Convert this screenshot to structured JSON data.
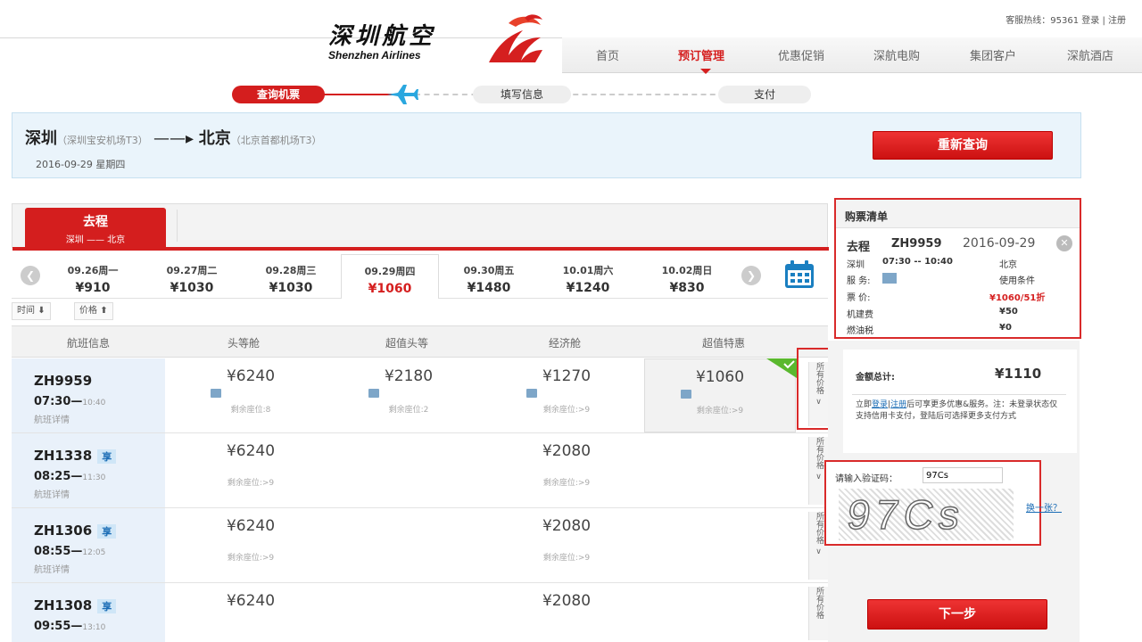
{
  "header": {
    "hotline": "客服热线：95361",
    "login": "登录",
    "register": "注册",
    "logo_cn": "深圳航空",
    "logo_en": "Shenzhen Airlines",
    "nav": [
      "首页",
      "预订管理",
      "优惠促销",
      "深航电购",
      "集团客户",
      "深航酒店"
    ],
    "nav_active_index": 1
  },
  "steps": [
    "查询机票",
    "填写信息",
    "支付"
  ],
  "route": {
    "from": "深圳",
    "from_airport": "（深圳宝安机场T3）",
    "to": "北京",
    "to_airport": "（北京首都机场T3）",
    "date": "2016-09-29 星期四",
    "research_label": "重新查询"
  },
  "trip_tab": {
    "label": "去程",
    "sub": "深圳 —— 北京"
  },
  "dates": [
    {
      "d": "09.26周一",
      "p": "¥910"
    },
    {
      "d": "09.27周二",
      "p": "¥1030"
    },
    {
      "d": "09.28周三",
      "p": "¥1030"
    },
    {
      "d": "09.29周四",
      "p": "¥1060"
    },
    {
      "d": "09.30周五",
      "p": "¥1480"
    },
    {
      "d": "10.01周六",
      "p": "¥1240"
    },
    {
      "d": "10.02周日",
      "p": "¥830"
    }
  ],
  "sort": {
    "time": "时间",
    "price": "价格"
  },
  "columns": [
    "航班信息",
    "头等舱",
    "超值头等",
    "经济舱",
    "超值特惠"
  ],
  "flights": [
    {
      "no": "ZH9959",
      "tag": "",
      "dep": "07:30—",
      "arr": "10:40",
      "detail": "航班详情",
      "fares": [
        {
          "p": "¥6240",
          "r": "剩余座位:8"
        },
        {
          "p": "¥2180",
          "r": "剩余座位:2"
        },
        {
          "p": "¥1270",
          "r": "剩余座位:>9"
        },
        {
          "p": "¥1060",
          "r": "剩余座位:>9"
        }
      ]
    },
    {
      "no": "ZH1338",
      "tag": "享",
      "dep": "08:25—",
      "arr": "11:30",
      "detail": "航班详情",
      "fares": [
        {
          "p": "¥6240",
          "r": "剩余座位:>9"
        },
        {
          "p": "",
          "r": ""
        },
        {
          "p": "¥2080",
          "r": "剩余座位:>9"
        },
        {
          "p": "",
          "r": ""
        }
      ]
    },
    {
      "no": "ZH1306",
      "tag": "享",
      "dep": "08:55—",
      "arr": "12:05",
      "detail": "航班详情",
      "fares": [
        {
          "p": "¥6240",
          "r": "剩余座位:>9"
        },
        {
          "p": "",
          "r": ""
        },
        {
          "p": "¥2080",
          "r": "剩余座位:>9"
        },
        {
          "p": "",
          "r": ""
        }
      ]
    },
    {
      "no": "ZH1308",
      "tag": "享",
      "dep": "09:55—",
      "arr": "13:10",
      "detail": "",
      "fares": [
        {
          "p": "¥6240",
          "r": ""
        },
        {
          "p": "",
          "r": ""
        },
        {
          "p": "¥2080",
          "r": ""
        },
        {
          "p": "",
          "r": ""
        }
      ]
    }
  ],
  "all_price": "所有价格",
  "cart": {
    "title": "购票清单",
    "trip": "去程",
    "flight": "ZH9959",
    "date": "2016-09-29",
    "dep": "深圳",
    "time": "07:30 -- 10:40",
    "arr": "北京",
    "service_label": "服 务:",
    "conditions": "使用条件",
    "fare_label": "票 价:",
    "fare": "¥1060/51折",
    "airport_fee_label": "机建费",
    "airport_fee": "¥50",
    "fuel_label": "燃油税",
    "fuel": "¥0"
  },
  "total": {
    "label": "金额总计:",
    "value": "¥1110",
    "note_prefix": "立即",
    "login": "登录",
    "register": "注册",
    "note": "后可享更多优惠&服务。注：未登录状态仅支持信用卡支付，登陆后可选择更多支付方式"
  },
  "captcha": {
    "label": "请输入验证码：",
    "value": "97Cs",
    "image_text": "97Cs",
    "refresh": "换一张？"
  },
  "next_label": "下一步",
  "colors": {
    "brand_red": "#d51f1f",
    "light_blue": "#eaf4fb",
    "highlight_frame": "#d92a2a"
  }
}
